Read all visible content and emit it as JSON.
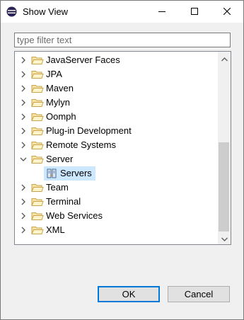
{
  "window": {
    "title": "Show View",
    "icon": "eclipse-icon"
  },
  "titlebar_buttons": [
    "minimize-icon",
    "maximize-icon",
    "close-icon"
  ],
  "filter": {
    "value": "",
    "placeholder": "type filter text"
  },
  "tree": {
    "items": [
      {
        "label": "JavaServer Faces",
        "expanded": false
      },
      {
        "label": "JPA",
        "expanded": false
      },
      {
        "label": "Maven",
        "expanded": false
      },
      {
        "label": "Mylyn",
        "expanded": false
      },
      {
        "label": "Oomph",
        "expanded": false
      },
      {
        "label": "Plug-in Development",
        "expanded": false
      },
      {
        "label": "Remote Systems",
        "expanded": false
      },
      {
        "label": "Server",
        "expanded": true,
        "children": [
          {
            "label": "Servers",
            "selected": true,
            "icon": "servers-view-icon"
          }
        ]
      },
      {
        "label": "Team",
        "expanded": false
      },
      {
        "label": "Terminal",
        "expanded": false
      },
      {
        "label": "Web Services",
        "expanded": false
      },
      {
        "label": "XML",
        "expanded": false
      }
    ]
  },
  "buttons": {
    "ok": "OK",
    "cancel": "Cancel"
  },
  "colors": {
    "selection": "#cce8ff",
    "folder": "#dcb67a",
    "default_button_border": "#0078d7"
  }
}
